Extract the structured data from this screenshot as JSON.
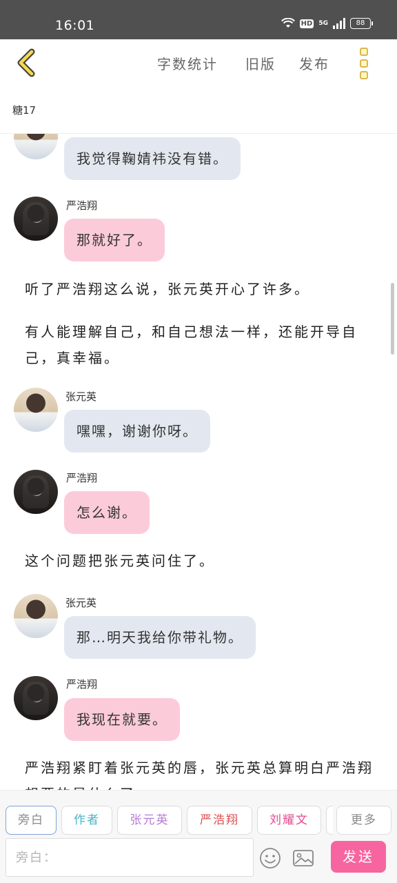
{
  "status_bar": {
    "time": "16:01",
    "hd_label": "HD",
    "network_label": "5G",
    "battery": "88"
  },
  "header": {
    "nav_links": [
      "字数统计",
      "旧版",
      "发布"
    ],
    "story_title": "糖17"
  },
  "messages": {
    "m1": {
      "text": "我觉得鞠婧祎没有错。"
    },
    "m2": {
      "speaker": "严浩翔",
      "text": "那就好了。"
    },
    "n1": {
      "text": "听了严浩翔这么说，张元英开心了许多。"
    },
    "n2": {
      "text": "有人能理解自己，和自己想法一样，还能开导自己，真幸福。"
    },
    "m3": {
      "speaker": "张元英",
      "text": "嘿嘿，谢谢你呀。"
    },
    "m4": {
      "speaker": "严浩翔",
      "text": "怎么谢。"
    },
    "n3": {
      "text": "这个问题把张元英问住了。"
    },
    "m5": {
      "speaker": "张元英",
      "text": "那…明天我给你带礼物。"
    },
    "m6": {
      "speaker": "严浩翔",
      "text": "我现在就要。"
    },
    "n4": {
      "text": "严浩翔紧盯着张元英的唇，张元英总算明白严浩翔想要的是什么了。"
    }
  },
  "roles": {
    "r0": {
      "label": "旁白",
      "color": "#8a8a8a"
    },
    "r1": {
      "label": "作者",
      "color": "#4bb3c7"
    },
    "r2": {
      "label": "张元英",
      "color": "#b77ad6"
    },
    "r3": {
      "label": "严浩翔",
      "color": "#e04b4b"
    },
    "r4": {
      "label": "刘耀文",
      "color": "#e04b8f"
    },
    "r5": {
      "label": "更多",
      "color": "#8a8a8a"
    }
  },
  "input": {
    "placeholder": "旁白：",
    "send_label": "发送"
  },
  "colors": {
    "accent": "#f765a0",
    "bubble_female": "#e3e8f0",
    "bubble_male": "#fccbd9"
  },
  "icons": [
    "back-arrow-icon",
    "menu-dots-icon",
    "emoji-icon",
    "image-icon",
    "wifi-icon",
    "signal-icon",
    "battery-icon"
  ]
}
